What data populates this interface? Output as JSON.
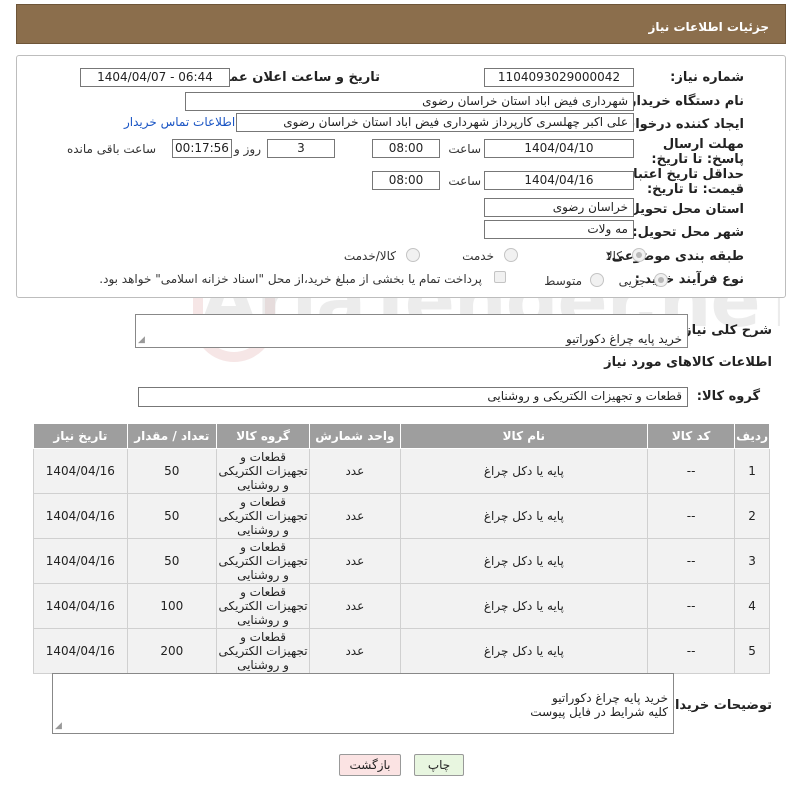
{
  "page_title": "جزئیات اطلاعات نیاز",
  "form": {
    "need_number_label": "شماره نیاز:",
    "need_number": "1104093029000042",
    "announce_label": "تاریخ و ساعت اعلان عمومی:",
    "announce_value": "1404/04/07 - 06:44",
    "buyer_org_label": "نام دستگاه خریدار:",
    "buyer_org": "شهرداری فیض اباد استان خراسان رضوی",
    "requester_label": "ایجاد کننده درخواست:",
    "requester": "علی اکبر چهلسری کارپرداز شهرداری فیض اباد استان خراسان رضوی",
    "contact_link": "اطلاعات تماس خریدار",
    "reply_deadline_label": "مهلت ارسال پاسخ: تا تاریخ:",
    "reply_date": "1404/04/10",
    "time_label": "ساعت",
    "reply_time": "08:00",
    "days_value": "3",
    "days_label": "روز و",
    "remaining_time": "00:17:56",
    "remaining_label": "ساعت باقی مانده",
    "price_validity_label": "حداقل تاریخ اعتبار قیمت: تا تاریخ:",
    "price_date": "1404/04/16",
    "price_time": "08:00",
    "province_label": "استان محل تحویل:",
    "province": "خراسان رضوی",
    "city_label": "شهر محل تحویل:",
    "city": "مه ولات",
    "category_label": "طبقه بندی موضوعی:",
    "category_options": [
      "کالا",
      "خدمت",
      "کالا/خدمت"
    ],
    "category_selected": "کالا",
    "process_label": "نوع فرآیند خرید :",
    "process_options": [
      "جزیی",
      "متوسط"
    ],
    "payment_note": "پرداخت تمام یا بخشی از مبلغ خرید،از محل \"اسناد خزانه اسلامی\" خواهد بود."
  },
  "summary": {
    "label": "شرح کلی نیاز:",
    "text": "خرید پایه چراغ دکوراتیو\nکلیه شرایط در فایل پیوست"
  },
  "goods_section_title": "اطلاعات کالاهای مورد نیاز",
  "goods_group": {
    "label": "گروه کالا:",
    "value": "قطعات و تجهیزات الکتریکی و روشنایی"
  },
  "table": {
    "headers": [
      "ردیف",
      "کد کالا",
      "نام کالا",
      "واحد شمارش",
      "گروه کالا",
      "تعداد / مقدار",
      "تاریخ نیاز"
    ],
    "rows": [
      [
        "1",
        "--",
        "پایه یا دکل چراغ",
        "عدد",
        "قطعات و تجهیزات الکتریکی و روشنایی",
        "50",
        "1404/04/16"
      ],
      [
        "2",
        "--",
        "پایه یا دکل چراغ",
        "عدد",
        "قطعات و تجهیزات الکتریکی و روشنایی",
        "50",
        "1404/04/16"
      ],
      [
        "3",
        "--",
        "پایه یا دکل چراغ",
        "عدد",
        "قطعات و تجهیزات الکتریکی و روشنایی",
        "50",
        "1404/04/16"
      ],
      [
        "4",
        "--",
        "پایه یا دکل چراغ",
        "عدد",
        "قطعات و تجهیزات الکتریکی و روشنایی",
        "100",
        "1404/04/16"
      ],
      [
        "5",
        "--",
        "پایه یا دکل چراغ",
        "عدد",
        "قطعات و تجهیزات الکتریکی و روشنایی",
        "200",
        "1404/04/16"
      ]
    ]
  },
  "buyer_notes": {
    "label": "توضیحات خریدار:",
    "text": "خرید پایه چراغ دکوراتیو\nکلیه شرایط در فایل پیوست"
  },
  "buttons": {
    "print": "چاپ",
    "back": "بازگشت"
  },
  "watermark": "AriaTender.neT",
  "colors": {
    "title_bar": "#8b6e4c",
    "table_header": "#9e9e9e",
    "link": "#1a55c4",
    "print_button": "#e8f6e0",
    "back_button": "#fbe3e3"
  }
}
